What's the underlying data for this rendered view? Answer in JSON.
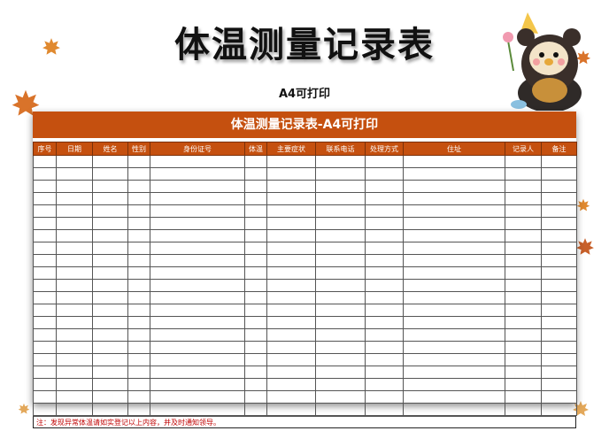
{
  "title": "体温测量记录表",
  "subtitle": "A4可打印",
  "banner": "体温测量记录表-A4可打印",
  "columns": [
    "序号",
    "日期",
    "姓名",
    "性别",
    "身份证号",
    "体温",
    "主要症状",
    "联系电话",
    "处理方式",
    "住址",
    "记录人",
    "备注"
  ],
  "empty_row_count": 21,
  "note": "注：发现异常体温请如实登记以上内容，并及时通知领导。",
  "colors": {
    "accent": "#c5500f",
    "note": "#c00000",
    "leaf": "#e07a2a"
  },
  "decorations": [
    "autumn-leaf-icon",
    "bear-mascot-icon"
  ]
}
